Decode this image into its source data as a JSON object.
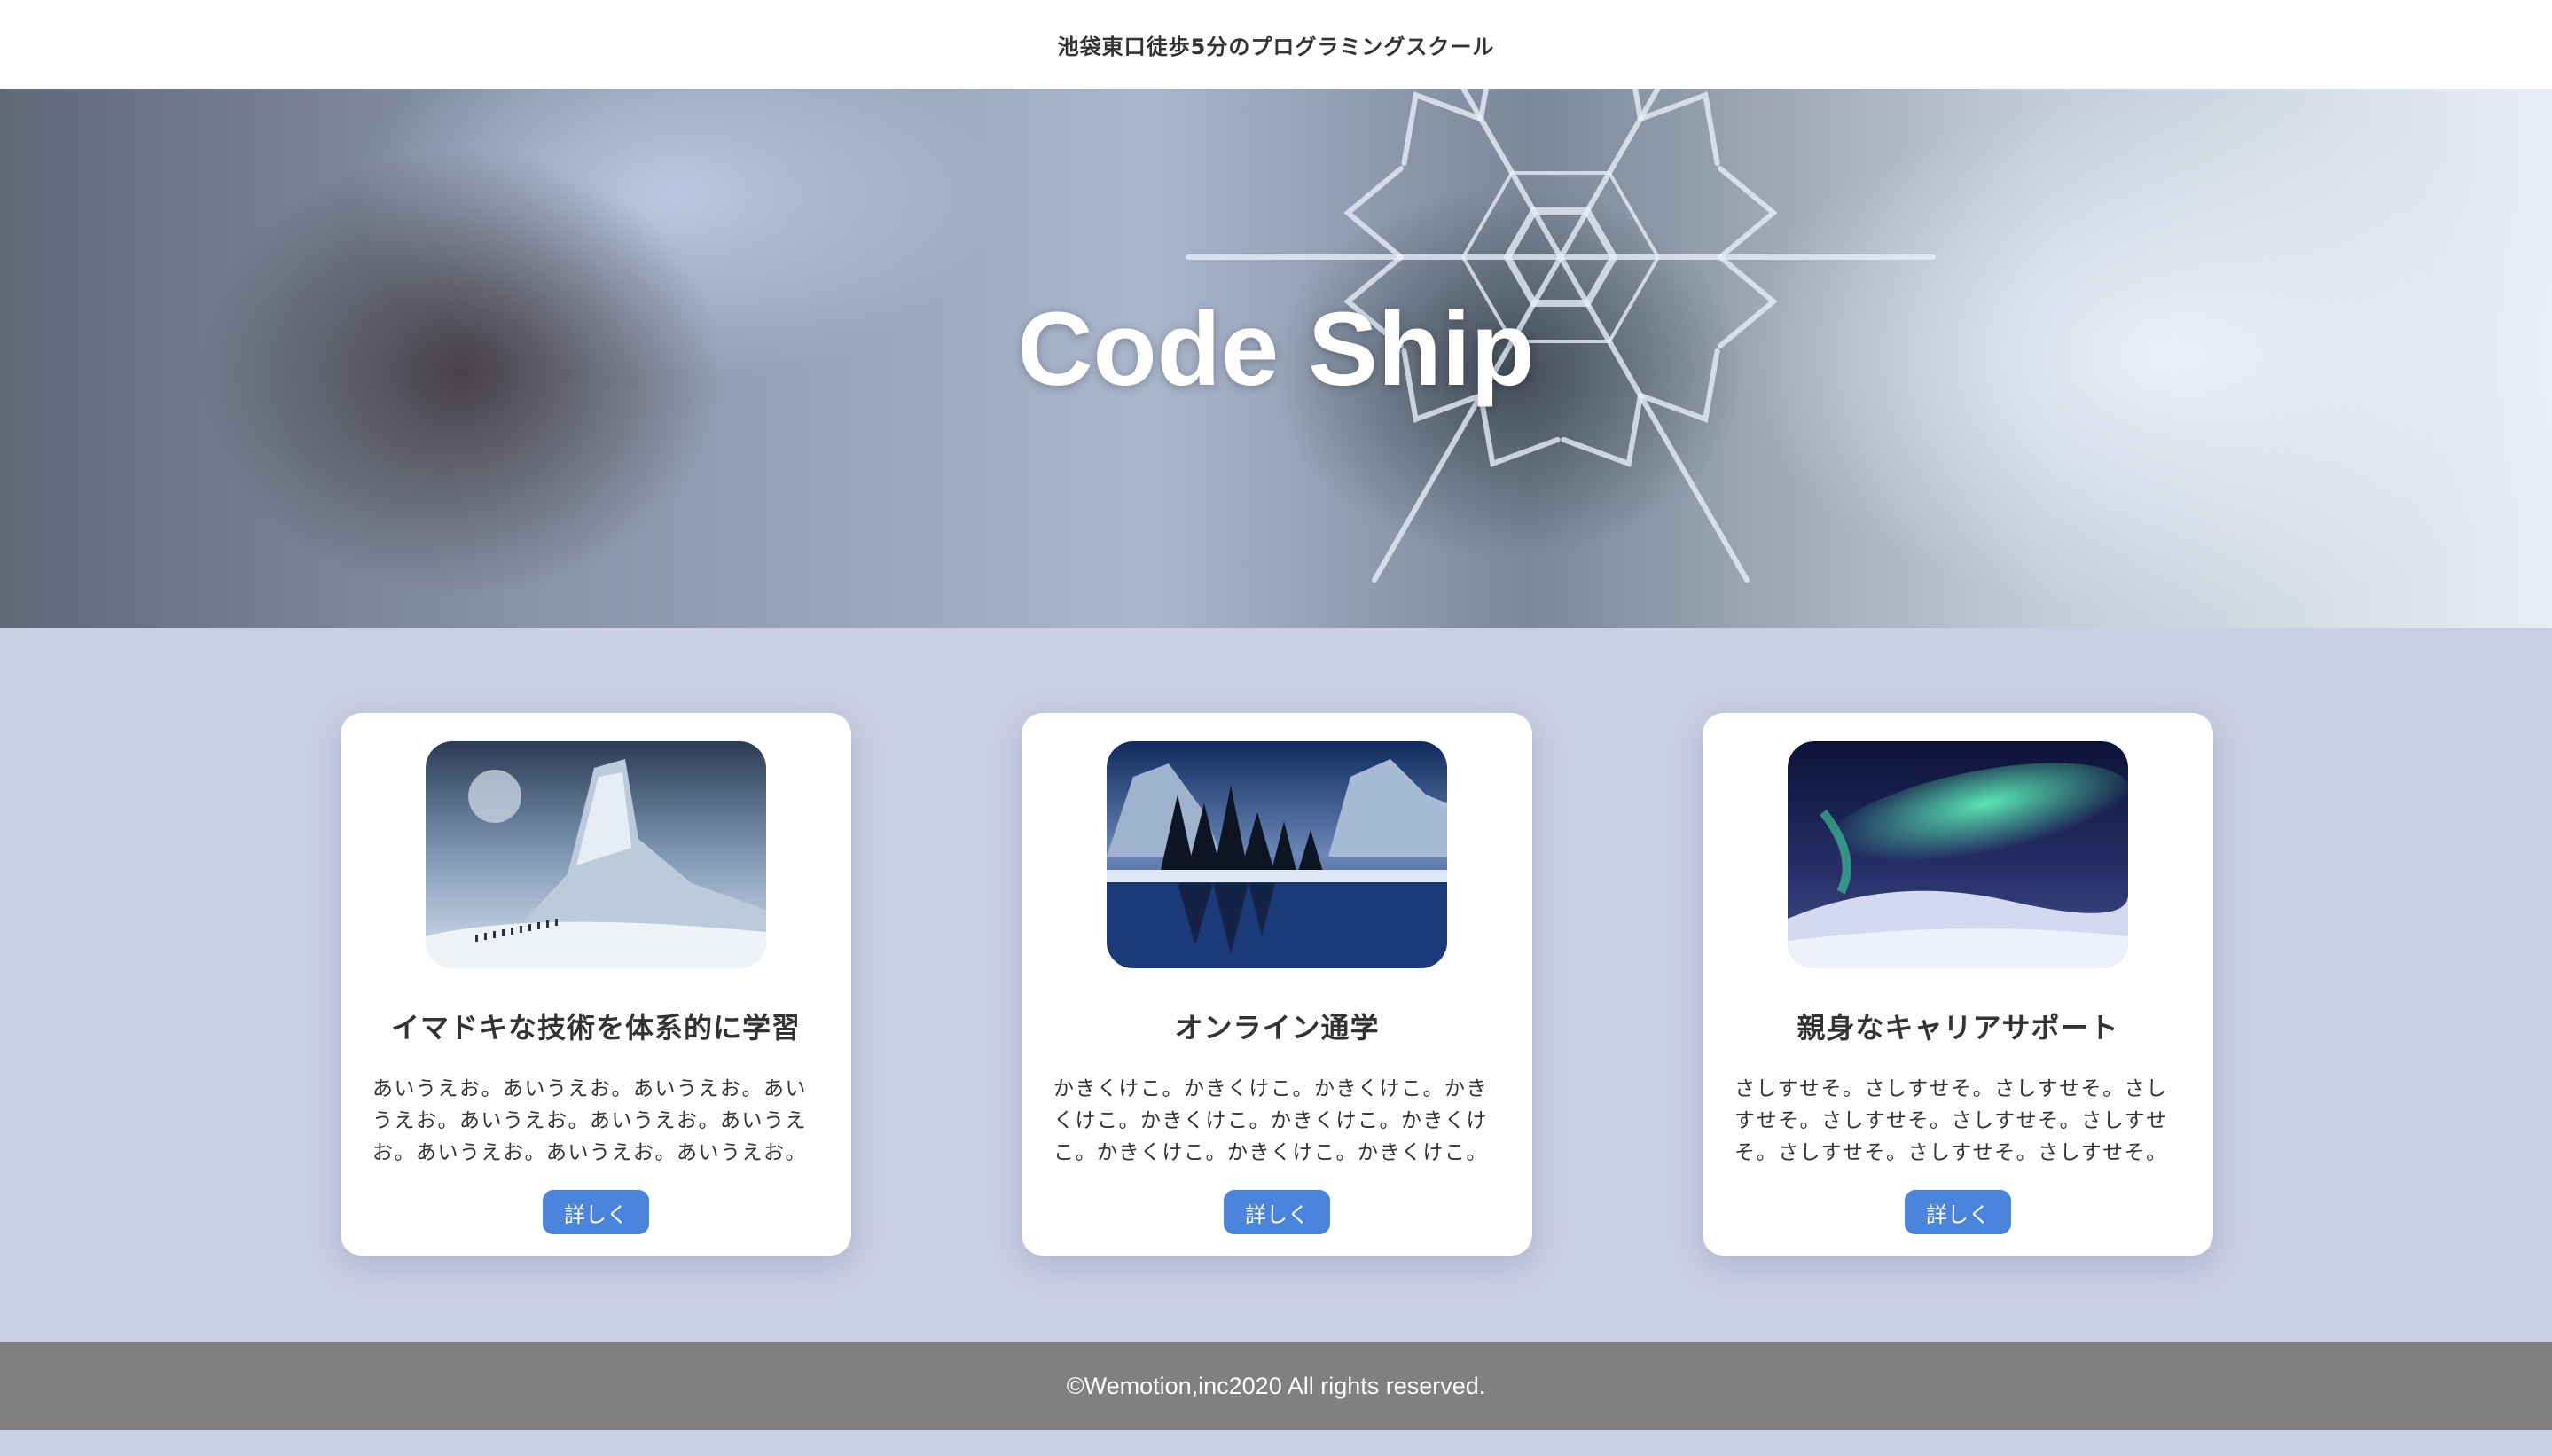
{
  "header": {
    "tagline": "池袋東口徒歩5分のプログラミングスクール"
  },
  "hero": {
    "title": "Code Ship"
  },
  "cards": [
    {
      "title": "イマドキな技術を体系的に学習",
      "text": "あいうえお。あいうえお。あいうえお。あいうえお。あいうえお。あいうえお。あいうえお。あいうえお。あいうえお。あいうえお。",
      "button_label": "詳しく",
      "image_icon": "ice-mountain-image"
    },
    {
      "title": "オンライン通学",
      "text": "かきくけこ。かきくけこ。かきくけこ。かきくけこ。かきくけこ。かきくけこ。かきくけこ。かきくけこ。かきくけこ。かきくけこ。",
      "button_label": "詳しく",
      "image_icon": "lake-forest-image"
    },
    {
      "title": "親身なキャリアサポート",
      "text": "さしすせそ。さしすせそ。さしすせそ。さしすせそ。さしすせそ。さしすせそ。さしすせそ。さしすせそ。さしすせそ。さしすせそ。",
      "button_label": "詳しく",
      "image_icon": "aurora-image"
    }
  ],
  "footer": {
    "copyright": "©Wemotion,inc2020 All rights reserved."
  },
  "colors": {
    "page_background": "#cbcfe4",
    "button": "#4a84dc",
    "footer": "#808080"
  }
}
